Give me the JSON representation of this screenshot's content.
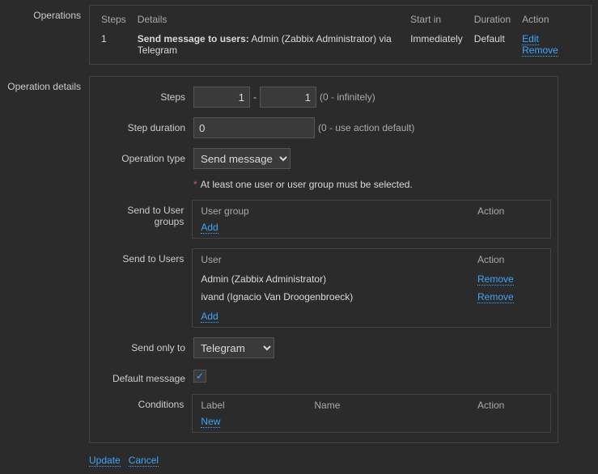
{
  "operations": {
    "section_label": "Operations",
    "headers": {
      "steps": "Steps",
      "details": "Details",
      "start_in": "Start in",
      "duration": "Duration",
      "action": "Action"
    },
    "rows": [
      {
        "step": "1",
        "details_bold": "Send message to users:",
        "details_rest": " Admin (Zabbix Administrator) via Telegram",
        "start_in": "Immediately",
        "duration": "Default",
        "edit": "Edit",
        "remove": "Remove"
      }
    ]
  },
  "opdetails": {
    "section_label": "Operation details",
    "steps": {
      "label": "Steps",
      "from": "1",
      "to": "1",
      "hint": "(0 - infinitely)"
    },
    "step_duration": {
      "label": "Step duration",
      "value": "0",
      "hint": "(0 - use action default)"
    },
    "operation_type": {
      "label": "Operation type",
      "selected": "Send message"
    },
    "requirement": {
      "asterisk": "*",
      "text": "At least one user or user group must be selected."
    },
    "user_groups": {
      "label": "Send to User groups",
      "header_group": "User group",
      "header_action": "Action",
      "add": "Add"
    },
    "users": {
      "label": "Send to Users",
      "header_user": "User",
      "header_action": "Action",
      "list": [
        {
          "name": "Admin (Zabbix Administrator)",
          "remove": "Remove"
        },
        {
          "name": "ivand (Ignacio Van Droogenbroeck)",
          "remove": "Remove"
        }
      ],
      "add": "Add"
    },
    "send_only_to": {
      "label": "Send only to",
      "selected": "Telegram"
    },
    "default_message": {
      "label": "Default message",
      "checked": true,
      "checkmark": "✓"
    },
    "conditions": {
      "label": "Conditions",
      "header_label": "Label",
      "header_name": "Name",
      "header_action": "Action",
      "new": "New"
    },
    "footer": {
      "update": "Update",
      "cancel": "Cancel"
    }
  }
}
